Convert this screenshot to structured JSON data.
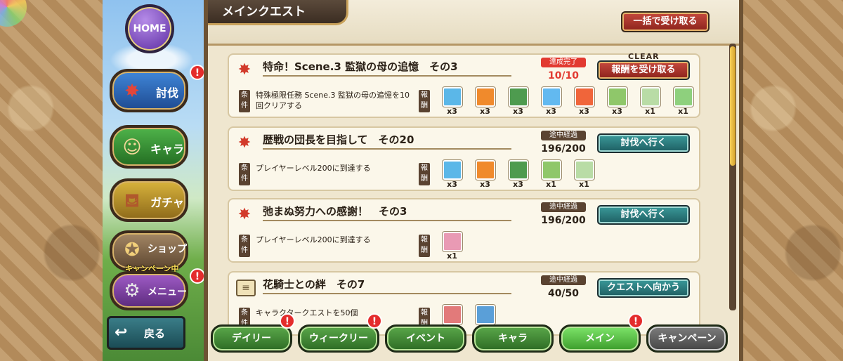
{
  "nav": {
    "home": "HOME",
    "subjugation": "討伐",
    "characters": "キャラ",
    "gacha": "ガチャ",
    "shop": "ショップ",
    "shop_badge": "キャンペーン中",
    "menu": "メニュー",
    "back": "戻る",
    "alert_mark": "!"
  },
  "panel": {
    "title": "メインクエスト",
    "claim_all": "一括で受け取る"
  },
  "labels": {
    "condition": "条件",
    "reward": "報酬"
  },
  "quests": [
    {
      "title": "特命！Scene.3 監獄の母の追憶　その3",
      "status": "達成完了",
      "progress": "10/10",
      "action": "報酬を受け取る",
      "clear_label": "CLEAR",
      "condition": "特殊極限任務 Scene.3 監獄の母の追憶を10回クリアする",
      "rewards": [
        {
          "color": "#5bb7e8",
          "qty": "x3"
        },
        {
          "color": "#f08a2c",
          "qty": "x3"
        },
        {
          "color": "#4e9b4f",
          "qty": "x3"
        },
        {
          "color": "#62b9f0",
          "qty": "x3"
        },
        {
          "color": "#f0653a",
          "qty": "x3"
        },
        {
          "color": "#8fc76a",
          "qty": "x3"
        },
        {
          "color": "#b9dca6",
          "qty": "x1"
        },
        {
          "color": "#8ed07d",
          "qty": "x1"
        }
      ]
    },
    {
      "title": "歴戦の団長を目指して　その20",
      "status": "途中経過",
      "progress": "196/200",
      "action": "討伐へ行く",
      "condition": "プレイヤーレベル200に到達する",
      "rewards": [
        {
          "color": "#5bb7e8",
          "qty": "x3"
        },
        {
          "color": "#f08a2c",
          "qty": "x3"
        },
        {
          "color": "#4e9b4f",
          "qty": "x3"
        },
        {
          "color": "#8fc76a",
          "qty": "x1"
        },
        {
          "color": "#b9dca6",
          "qty": "x1"
        }
      ]
    },
    {
      "title": "弛まぬ努力への感謝！　その3",
      "status": "途中経過",
      "progress": "196/200",
      "action": "討伐へ行く",
      "condition": "プレイヤーレベル200に到達する",
      "rewards": [
        {
          "color": "#e99ab4",
          "qty": "x1"
        }
      ]
    },
    {
      "title": "花騎士との絆　その7",
      "status": "途中経過",
      "progress": "40/50",
      "action": "クエストへ向かう",
      "condition": "キャラクタークエストを50個",
      "rewards": [
        {
          "color": "#e27a7a",
          "qty": ""
        },
        {
          "color": "#5a9fd8",
          "qty": ""
        }
      ]
    }
  ],
  "tabs": [
    "デイリー",
    "ウィークリー",
    "イベント",
    "キャラ",
    "メイン",
    "キャンペーン"
  ]
}
